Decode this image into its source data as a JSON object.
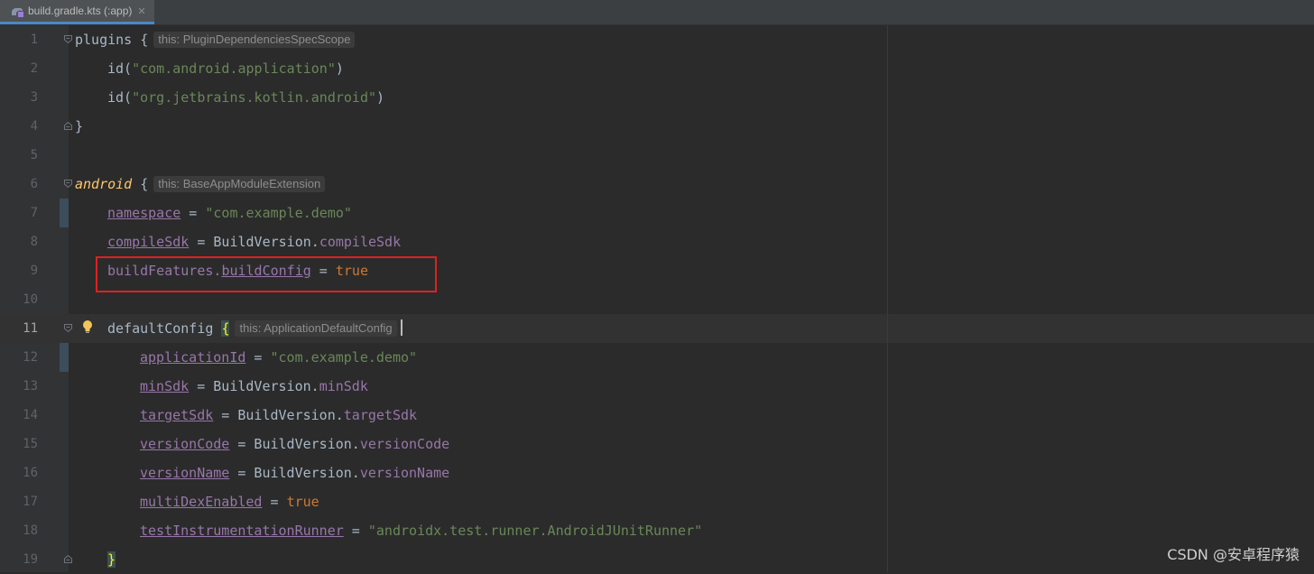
{
  "tab": {
    "label": "build.gradle.kts (:app)",
    "close": "✕",
    "icon": "gradle-kotlin-file-icon"
  },
  "lines": [
    {
      "n": "1"
    },
    {
      "n": "2"
    },
    {
      "n": "3"
    },
    {
      "n": "4"
    },
    {
      "n": "5"
    },
    {
      "n": "6"
    },
    {
      "n": "7"
    },
    {
      "n": "8"
    },
    {
      "n": "9"
    },
    {
      "n": "10"
    },
    {
      "n": "11"
    },
    {
      "n": "12"
    },
    {
      "n": "13"
    },
    {
      "n": "14"
    },
    {
      "n": "15"
    },
    {
      "n": "16"
    },
    {
      "n": "17"
    },
    {
      "n": "18"
    },
    {
      "n": "19"
    }
  ],
  "code": {
    "l1": {
      "kw": "plugins",
      "brace": " {",
      "hint": "this: PluginDependenciesSpecScope"
    },
    "l2": {
      "fn": "id(",
      "str": "\"com.android.application\"",
      "close": ")"
    },
    "l3": {
      "fn": "id(",
      "str": "\"org.jetbrains.kotlin.android\"",
      "close": ")"
    },
    "l4": {
      "text": "}"
    },
    "l6": {
      "kw": "android",
      "brace": " {",
      "hint": "this: BaseAppModuleExtension"
    },
    "l7": {
      "prop": "namespace",
      "eq": " = ",
      "str": "\"com.example.demo\""
    },
    "l8": {
      "prop": "compileSdk",
      "eq": " = BuildVersion.",
      "val": "compileSdk"
    },
    "l9": {
      "obj": "buildFeatures.",
      "prop": "buildConfig",
      "eq": " = ",
      "bool": "true"
    },
    "l11": {
      "kw": "defaultConfig",
      "brace": "{",
      "hint": "this: ApplicationDefaultConfig"
    },
    "l12": {
      "prop": "applicationId",
      "eq": " = ",
      "str": "\"com.example.demo\""
    },
    "l13": {
      "prop": "minSdk",
      "eq": " = BuildVersion.",
      "val": "minSdk"
    },
    "l14": {
      "prop": "targetSdk",
      "eq": " = BuildVersion.",
      "val": "targetSdk"
    },
    "l15": {
      "prop": "versionCode",
      "eq": " = BuildVersion.",
      "val": "versionCode"
    },
    "l16": {
      "prop": "versionName",
      "eq": " = BuildVersion.",
      "val": "versionName"
    },
    "l17": {
      "prop": "multiDexEnabled",
      "eq": " = ",
      "bool": "true"
    },
    "l18": {
      "prop": "testInstrumentationRunner",
      "eq": " = ",
      "str": "\"androidx.test.runner.AndroidJUnitRunner\""
    },
    "l19": {
      "text": "}"
    }
  },
  "watermark": "CSDN @安卓程序猿",
  "colors": {
    "background": "#2b2b2b",
    "string": "#6a8759",
    "property": "#9876aa",
    "keyword": "#cc7832",
    "highlight_box": "#e02020"
  }
}
